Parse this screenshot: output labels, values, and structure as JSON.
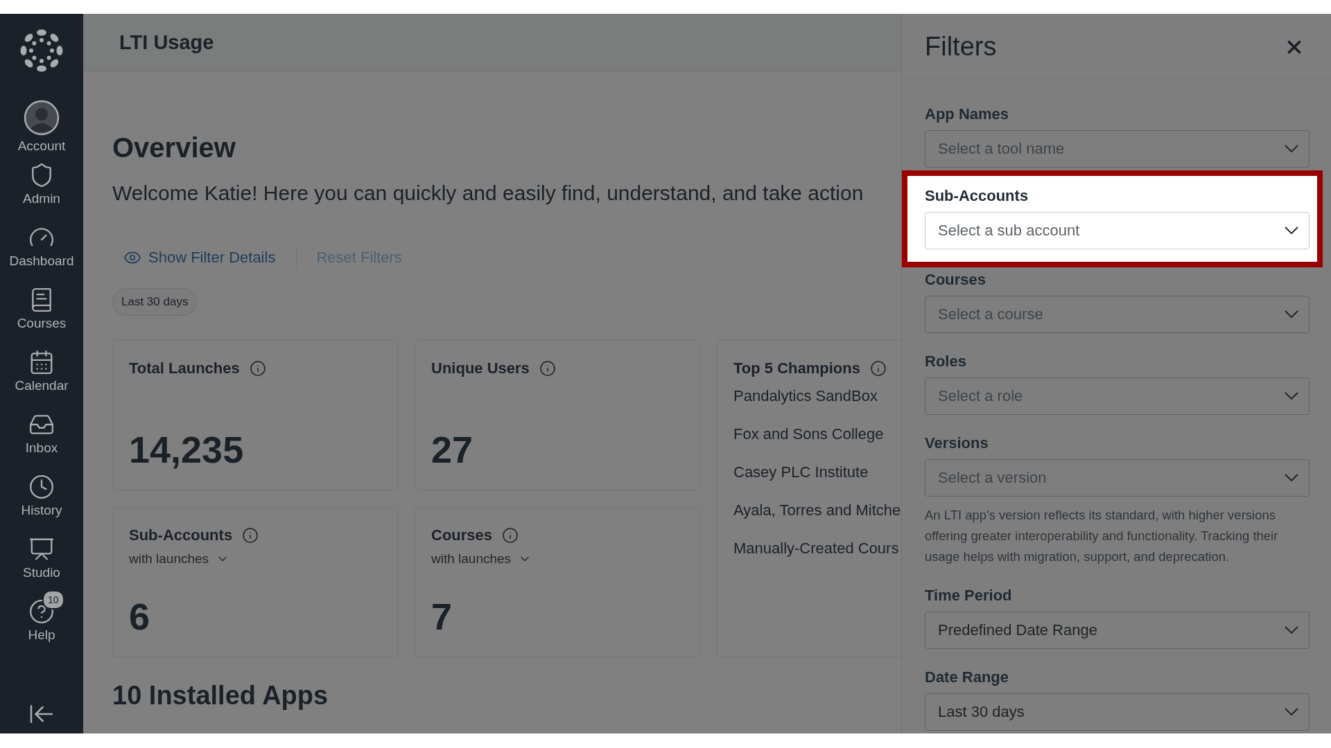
{
  "sidebar": {
    "items": [
      {
        "label": "Account"
      },
      {
        "label": "Admin"
      },
      {
        "label": "Dashboard"
      },
      {
        "label": "Courses"
      },
      {
        "label": "Calendar"
      },
      {
        "label": "Inbox"
      },
      {
        "label": "History"
      },
      {
        "label": "Studio"
      },
      {
        "label": "Help",
        "badge": "10"
      }
    ]
  },
  "header": {
    "title": "LTI Usage"
  },
  "overview": {
    "title": "Overview",
    "welcome": "Welcome Katie! Here you can quickly and easily find, understand, and take action",
    "show_filter_details": "Show Filter Details",
    "reset_filters": "Reset Filters",
    "chips": [
      "Last 30 days"
    ]
  },
  "cards": [
    {
      "title": "Total Launches",
      "value": "14,235"
    },
    {
      "title": "Unique Users",
      "value": "27"
    },
    {
      "title": "Sub-Accounts",
      "dropdown": "with launches",
      "value": "6"
    },
    {
      "title": "Courses",
      "dropdown": "with launches",
      "value": "7"
    }
  ],
  "champions": {
    "title": "Top 5 Champions",
    "items": [
      "Pandalytics SandBox",
      "Fox and Sons College",
      "Casey PLC Institute",
      "Ayala, Torres and Mitche",
      "Manually-Created Cours"
    ]
  },
  "installed_apps": {
    "title": "10 Installed Apps"
  },
  "filters": {
    "title": "Filters",
    "sections": [
      {
        "label": "App Names",
        "placeholder": "Select a tool name",
        "highlighted": false
      },
      {
        "label": "Sub-Accounts",
        "placeholder": "Select a sub account",
        "highlighted": true
      },
      {
        "label": "Courses",
        "placeholder": "Select a course",
        "highlighted": false
      },
      {
        "label": "Roles",
        "placeholder": "Select a role",
        "highlighted": false
      },
      {
        "label": "Versions",
        "placeholder": "Select a version",
        "highlighted": false,
        "note": "An LTI app's version reflects its standard, with higher versions offering greater interoperability and functionality. Tracking their usage helps with migration, support, and deprecation."
      },
      {
        "label": "Time Period",
        "value": "Predefined Date Range",
        "highlighted": false
      },
      {
        "label": "Date Range",
        "value": "Last 30 days",
        "highlighted": false
      }
    ]
  }
}
